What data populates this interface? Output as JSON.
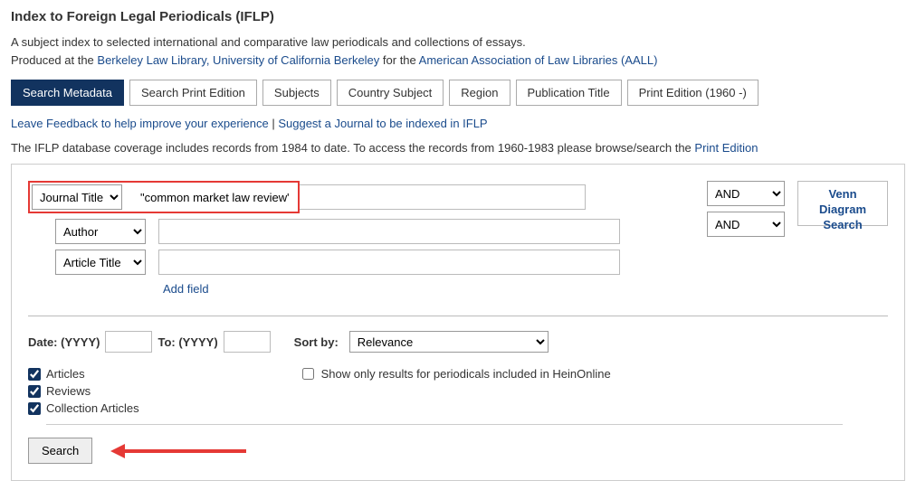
{
  "title": "Index to Foreign Legal Periodicals (IFLP)",
  "desc_line1": "A subject index to selected international and comparative law periodicals and collections of essays.",
  "desc_prefix": "Produced at the ",
  "desc_link1": "Berkeley Law Library, University of California Berkeley",
  "desc_mid": " for the ",
  "desc_link2": "American Association of Law Libraries (AALL)",
  "tabs": {
    "t0": "Search Metadata",
    "t1": "Search Print Edition",
    "t2": "Subjects",
    "t3": "Country Subject",
    "t4": "Region",
    "t5": "Publication Title",
    "t6": "Print Edition (1960 -)"
  },
  "feedback": {
    "leave": "Leave Feedback to help improve your experience",
    "sep": " | ",
    "suggest": "Suggest a Journal to be indexed in IFLP"
  },
  "coverage_pre": "The IFLP database coverage includes records from 1984 to date. To access the records from 1960-1983 please browse/search the ",
  "coverage_link": "Print Edition",
  "fields": {
    "f0": {
      "label": "Journal Title",
      "value": "\"common market law review\""
    },
    "f1": {
      "label": "Author",
      "value": ""
    },
    "f2": {
      "label": "Article Title",
      "value": ""
    }
  },
  "bool": {
    "b0": "AND",
    "b1": "AND"
  },
  "add_field": "Add field",
  "venn": "Venn Diagram Search",
  "date": {
    "label": "Date: (YYYY)",
    "to": "To: (YYYY)",
    "sort_label": "Sort by:",
    "sort_value": "Relevance"
  },
  "checks": {
    "c0": "Articles",
    "c1": "Reviews",
    "c2": "Collection Articles",
    "hein": "Show only results for periodicals included in HeinOnline"
  },
  "search_btn": "Search"
}
